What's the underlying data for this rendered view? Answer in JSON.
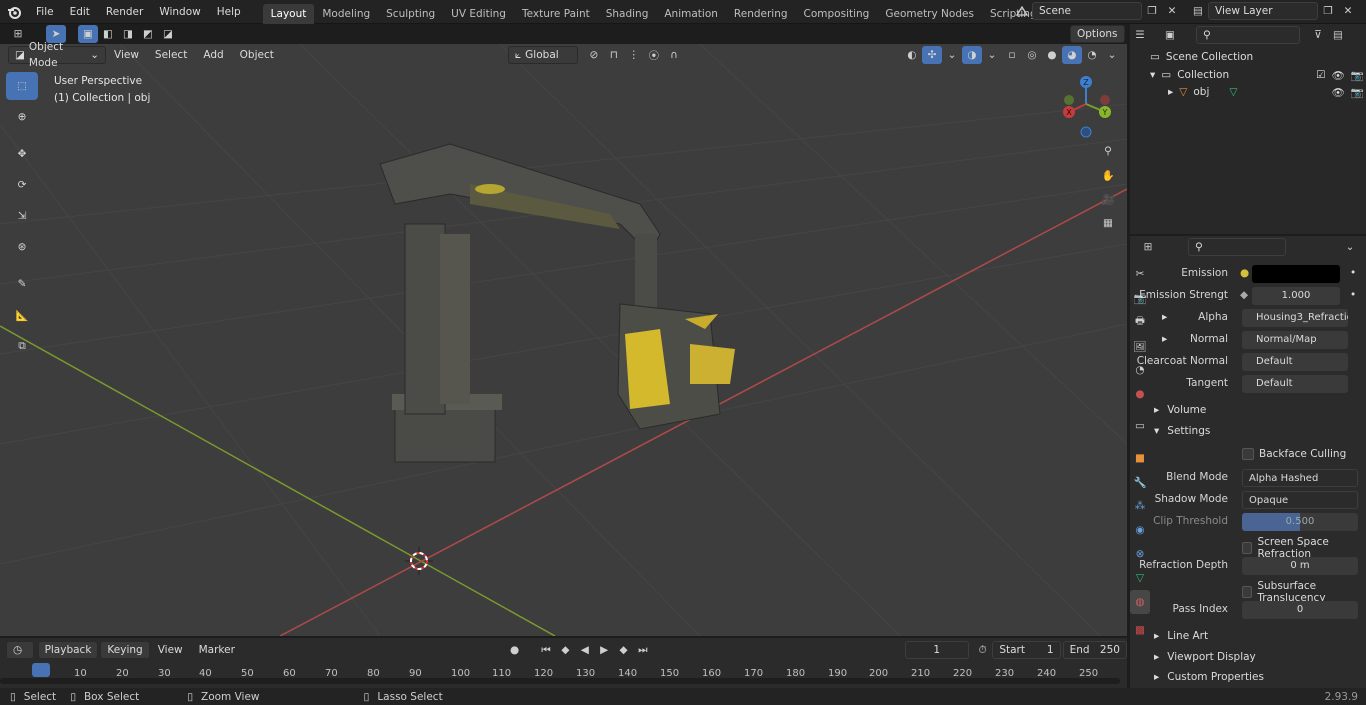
{
  "menu": [
    "File",
    "Edit",
    "Render",
    "Window",
    "Help"
  ],
  "workspaces": [
    "Layout",
    "Modeling",
    "Sculpting",
    "UV Editing",
    "Texture Paint",
    "Shading",
    "Animation",
    "Rendering",
    "Compositing",
    "Geometry Nodes",
    "Scripting"
  ],
  "active_workspace": "Layout",
  "scene": "Scene",
  "view_layer": "View Layer",
  "viewport": {
    "mode": "Object Mode",
    "menus": [
      "View",
      "Select",
      "Add",
      "Object"
    ],
    "transform": "Global",
    "options": "Options",
    "overlay_title": "User Perspective",
    "overlay_sub": "(1) Collection | obj",
    "gizmo": {
      "x": "X",
      "y": "Y",
      "z": "Z"
    }
  },
  "outliner": {
    "root": "Scene Collection",
    "collection": "Collection",
    "object": "obj"
  },
  "properties": {
    "rows": [
      {
        "label": "Emission",
        "value": ""
      },
      {
        "label": "Emission Strengt",
        "value": "1.000"
      },
      {
        "label": "Alpha",
        "value": "Housing3_Refractio..."
      },
      {
        "label": "Normal",
        "value": "Normal/Map"
      },
      {
        "label": "Clearcoat Normal",
        "value": "Default"
      },
      {
        "label": "Tangent",
        "value": "Default"
      }
    ],
    "volume": "Volume",
    "settings": "Settings",
    "backface": "Backface Culling",
    "blend_label": "Blend Mode",
    "blend_value": "Alpha Hashed",
    "shadow_label": "Shadow Mode",
    "shadow_value": "Opaque",
    "clip_label": "Clip Threshold",
    "clip_value": "0.500",
    "ssr": "Screen Space Refraction",
    "refr_label": "Refraction Depth",
    "refr_value": "0 m",
    "subsurface": "Subsurface Translucency",
    "pass_label": "Pass Index",
    "pass_value": "0",
    "line_art": "Line Art",
    "viewport_display": "Viewport Display",
    "custom_props": "Custom Properties"
  },
  "timeline": {
    "menus": [
      "Playback",
      "Keying",
      "View",
      "Marker"
    ],
    "current_frame": "1",
    "start_label": "Start",
    "start": "1",
    "end_label": "End",
    "end": "250",
    "ticks": [
      "1",
      "10",
      "20",
      "30",
      "40",
      "50",
      "60",
      "70",
      "80",
      "90",
      "100",
      "110",
      "120",
      "130",
      "140",
      "150",
      "160",
      "170",
      "180",
      "190",
      "200",
      "210",
      "220",
      "230",
      "240",
      "250"
    ]
  },
  "status": {
    "select": "Select",
    "box_select": "Box Select",
    "zoom_view": "Zoom View",
    "lasso_select": "Lasso Select",
    "version": "2.93.9"
  }
}
